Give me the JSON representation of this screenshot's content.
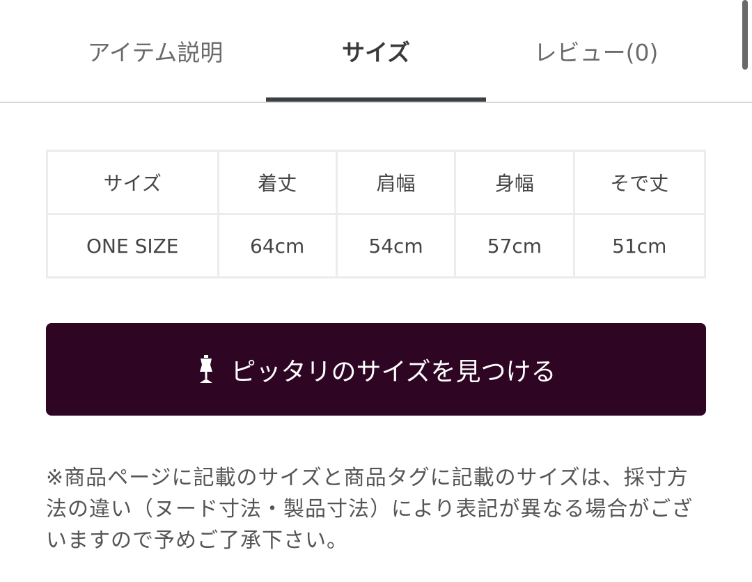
{
  "tabs": [
    {
      "label": "アイテム説明"
    },
    {
      "label": "サイズ"
    },
    {
      "label": "レビュー(0)"
    }
  ],
  "size_table": {
    "headers": [
      "サイズ",
      "着丈",
      "肩幅",
      "身幅",
      "そで丈"
    ],
    "rows": [
      [
        "ONE SIZE",
        "64cm",
        "54cm",
        "57cm",
        "51cm"
      ]
    ]
  },
  "fit_button": {
    "label": "ピッタリのサイズを見つける",
    "icon": "dress-form-icon"
  },
  "note": {
    "text": "※商品ページに記載のサイズと商品タグに記載のサイズは、採寸方法の違い（ヌード寸法・製品寸法）により表記が異なる場合がございますので予めご了承下さい。"
  },
  "colors": {
    "button_bg": "#2e0523",
    "active_tab_underline": "#3c3f46"
  }
}
